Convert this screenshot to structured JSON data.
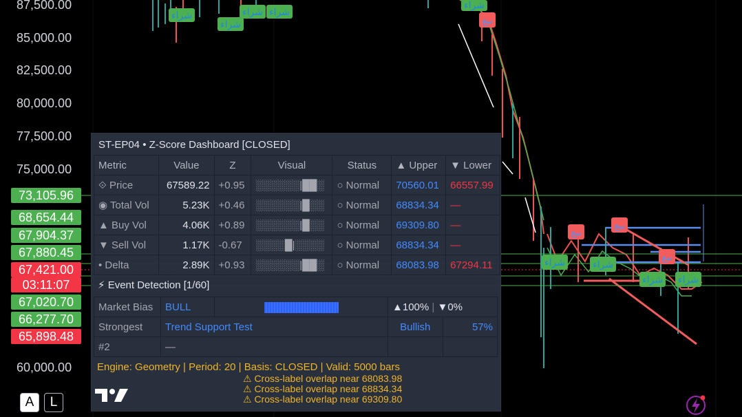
{
  "price_axis": {
    "labels": [
      "87,500.00",
      "85,000.00",
      "82,500.00",
      "80,000.00",
      "77,500.00",
      "75,000.00",
      "60,000.00"
    ],
    "tags": [
      {
        "text": "73,105.96",
        "color": "#4caf50"
      },
      {
        "text": "68,654.44",
        "color": "#4caf50"
      },
      {
        "text": "67,904.37",
        "color": "#4caf50"
      },
      {
        "text": "67,880.45",
        "color": "#4caf50"
      },
      {
        "text": "67,421.00",
        "color": "#f23645"
      },
      {
        "text": "03:11:07",
        "color": "#f23645"
      },
      {
        "text": "67,020.70",
        "color": "#4caf50"
      },
      {
        "text": "66,277.70",
        "color": "#4caf50"
      },
      {
        "text": "65,898.48",
        "color": "#f23645"
      }
    ]
  },
  "signals": {
    "buy": "شراء",
    "sell": "بيع"
  },
  "dashboard": {
    "title": "ST-EP04 • Z-Score Dashboard  [CLOSED]",
    "headers": {
      "metric": "Metric",
      "value": "Value",
      "z": "Z",
      "visual": "Visual",
      "status": "Status",
      "upper": "▲ Upper",
      "lower": "▼ Lower"
    },
    "rows": [
      {
        "metric": "⟐ Price",
        "value": "67589.22",
        "z": "+0.95",
        "visual": "░░░░░░|██░",
        "status": "○ Normal",
        "upper": "70560.01",
        "lower": "66557.99"
      },
      {
        "metric": "◉ Total Vol",
        "value": "5.23K",
        "z": "+0.46",
        "visual": "░░░░░░|█░░",
        "status": "○ Normal",
        "upper": "68834.34",
        "lower": "—"
      },
      {
        "metric": "▲ Buy Vol",
        "value": "4.06K",
        "z": "+0.89",
        "visual": "░░░░░░|█░░",
        "status": "○ Normal",
        "upper": "69309.80",
        "lower": "—"
      },
      {
        "metric": "▼ Sell Vol",
        "value": "1.17K",
        "z": "-0.67",
        "visual": "░░░░█|░░░░",
        "status": "○ Normal",
        "upper": "68834.34",
        "lower": "—"
      },
      {
        "metric": "• Delta",
        "value": "2.89K",
        "z": "+0.93",
        "visual": "░░░░░░|██░",
        "status": "○ Normal",
        "upper": "68083.98",
        "lower": "67294.11"
      }
    ],
    "event": "⚡ Event Detection [1/60]",
    "bias": {
      "label": "Market Bias",
      "value": "BULL",
      "up": "▲100%",
      "down": "▼0%"
    },
    "strongest": {
      "label": "Strongest",
      "value": "Trend Support Test",
      "dir": "Bullish",
      "pct": "57%"
    },
    "second": {
      "label": "#2",
      "value": "—"
    },
    "footer": "Engine: Geometry  |  Period: 20  |  Basis: CLOSED  |  Valid: 5000 bars",
    "warnings": [
      "⚠ Cross-label overlap near 68083.98",
      "⚠ Cross-label overlap near 68834.34",
      "⚠ Cross-label overlap near 69309.80"
    ]
  },
  "buttons": {
    "auto": "A",
    "log": "L"
  }
}
